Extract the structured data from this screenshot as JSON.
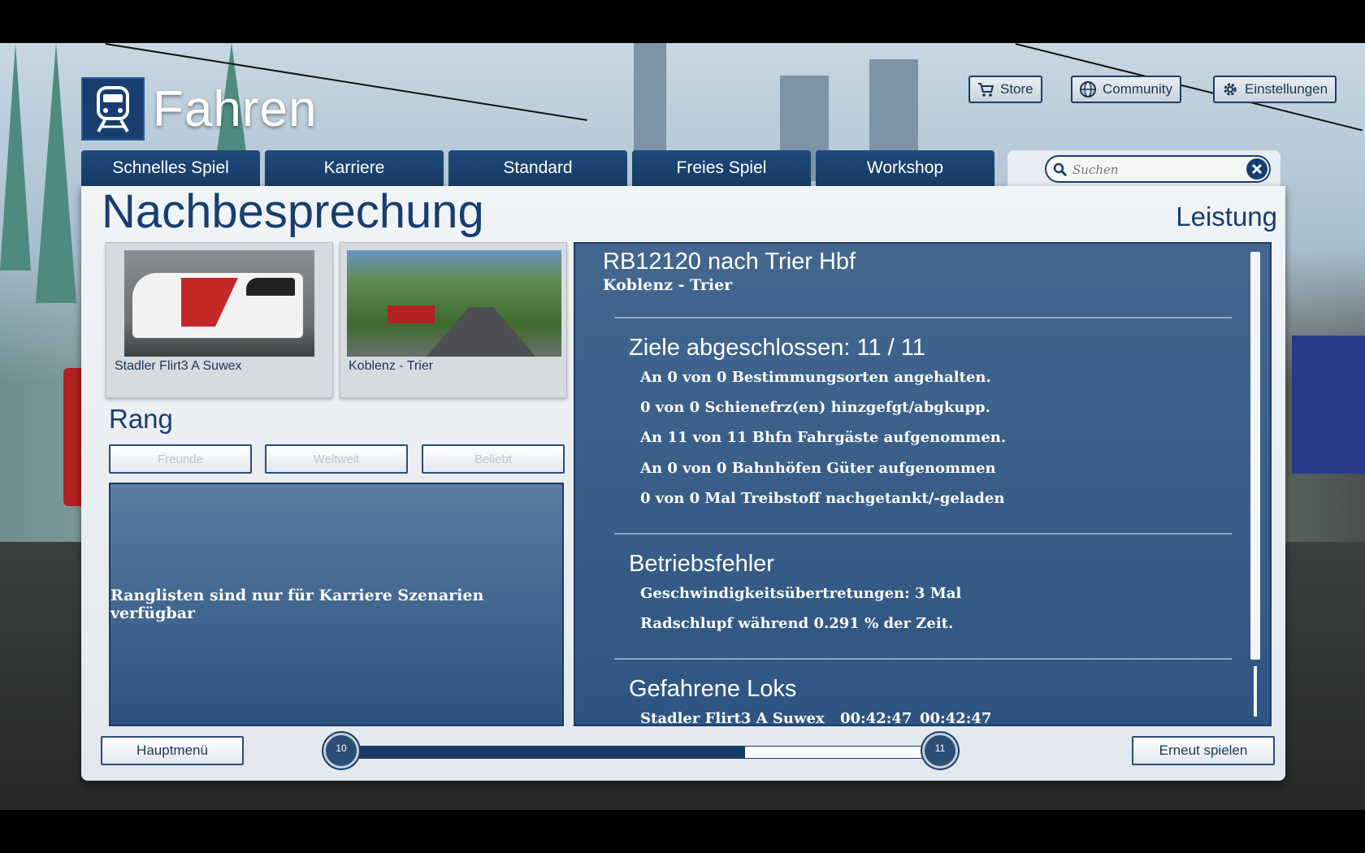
{
  "app": {
    "title": "Fahren"
  },
  "topbar": {
    "store": "Store",
    "community": "Community",
    "settings": "Einstellungen"
  },
  "tabs": [
    {
      "label": "Schnelles Spiel"
    },
    {
      "label": "Karriere"
    },
    {
      "label": "Standard"
    },
    {
      "label": "Freies Spiel"
    },
    {
      "label": "Workshop"
    }
  ],
  "search": {
    "placeholder": "Suchen",
    "value": ""
  },
  "page": {
    "title": "Nachbesprechung",
    "section_right": "Leistung"
  },
  "cards": [
    {
      "caption": "Stadler Flirt3 A Suwex"
    },
    {
      "caption": "Koblenz - Trier"
    }
  ],
  "rank": {
    "title": "Rang",
    "buttons": [
      {
        "label": "Freunde"
      },
      {
        "label": "Weltweit"
      },
      {
        "label": "Beliebt"
      }
    ],
    "message": "Ranglisten sind nur für Karriere Szenarien verfügbar"
  },
  "performance": {
    "scenario": "RB12120 nach Trier Hbf",
    "route": "Koblenz - Trier",
    "goals": {
      "title": "Ziele abgeschlossen: 11 / 11",
      "lines": [
        "An 0 von 0 Bestimmungsorten angehalten.",
        "0 von 0 Schienefrz(en) hinzgefgt/abgkupp.",
        "An 11 von 11 Bhfn Fahrgäste aufgenommen.",
        "An 0 von 0 Bahnhöfen Güter aufgenommen",
        "0 von 0 Mal Treibstoff nachgetankt/-geladen"
      ]
    },
    "errors": {
      "title": "Betriebsfehler",
      "lines": [
        "Geschwindigkeitsübertretungen: 3 Mal",
        "Radschlupf während 0.291 % der Zeit."
      ]
    },
    "locos": {
      "title": "Gefahrene Loks",
      "rows": [
        {
          "name": "Stadler Flirt3 A Suwex",
          "time1": "00:42:47",
          "time2": "00:42:47"
        }
      ]
    }
  },
  "footer": {
    "main_menu": "Hauptmenü",
    "replay": "Erneut spielen",
    "level_from": "10",
    "level_to": "11",
    "level_progress": 0.68
  },
  "colors": {
    "accent": "#183d6f",
    "panel": "#2e5582"
  }
}
